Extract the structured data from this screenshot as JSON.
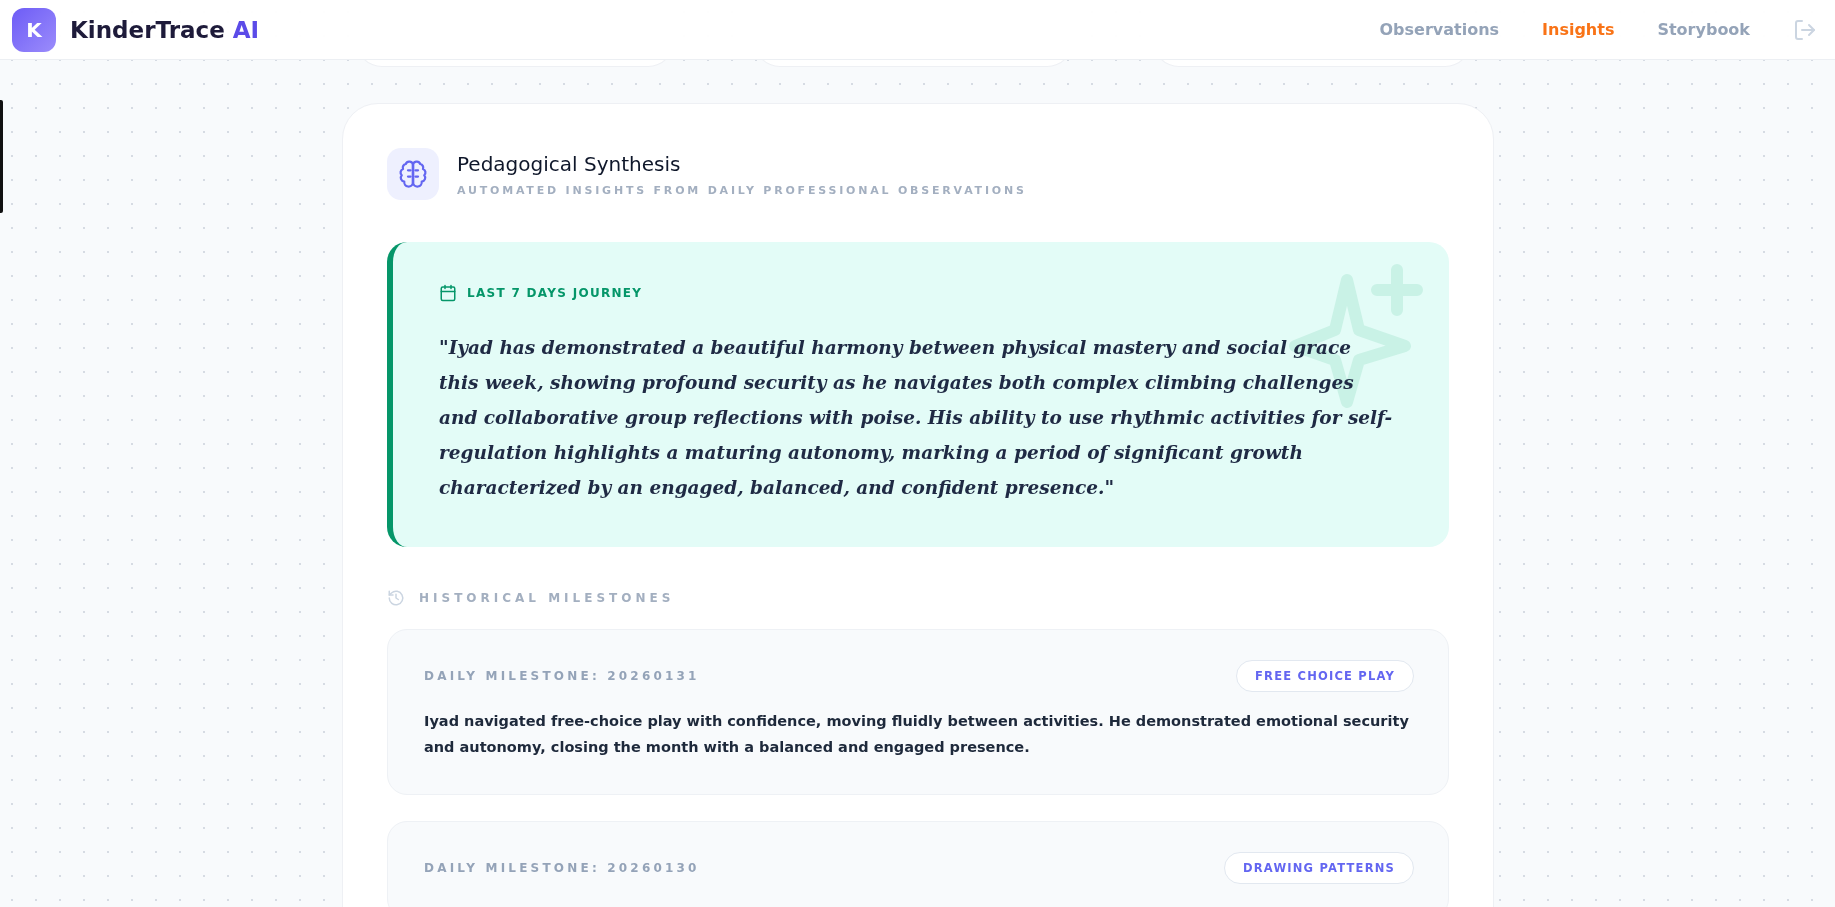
{
  "brand": {
    "logo_letter": "K",
    "name": "KinderTrace",
    "name_accent": "AI"
  },
  "nav": [
    {
      "label": "Observations",
      "selected": false
    },
    {
      "label": "Insights",
      "selected": true
    },
    {
      "label": "Storybook",
      "selected": false
    }
  ],
  "synthesis": {
    "title": "Pedagogical Synthesis",
    "subtitle": "AUTOMATED INSIGHTS FROM DAILY PROFESSIONAL OBSERVATIONS",
    "journey": {
      "label": "LAST 7 DAYS JOURNEY",
      "quote": "\"Iyad has demonstrated a beautiful harmony between physical mastery and social grace this week, showing profound security as he navigates both complex climbing challenges and collaborative group reflections with poise. His ability to use rhythmic activities for self-regulation highlights a maturing autonomy, marking a period of significant growth characterized by an engaged, balanced, and confident presence.\""
    },
    "history_label": "HISTORICAL MILESTONES",
    "milestones": [
      {
        "heading": "DAILY MILESTONE: 20260131",
        "tag": "FREE CHOICE PLAY",
        "text": "Iyad navigated free-choice play with confidence, moving fluidly between activities. He demonstrated emotional security and autonomy, closing the month with a balanced and engaged presence."
      },
      {
        "heading": "DAILY MILESTONE: 20260130",
        "tag": "DRAWING PATTERNS"
      }
    ]
  }
}
